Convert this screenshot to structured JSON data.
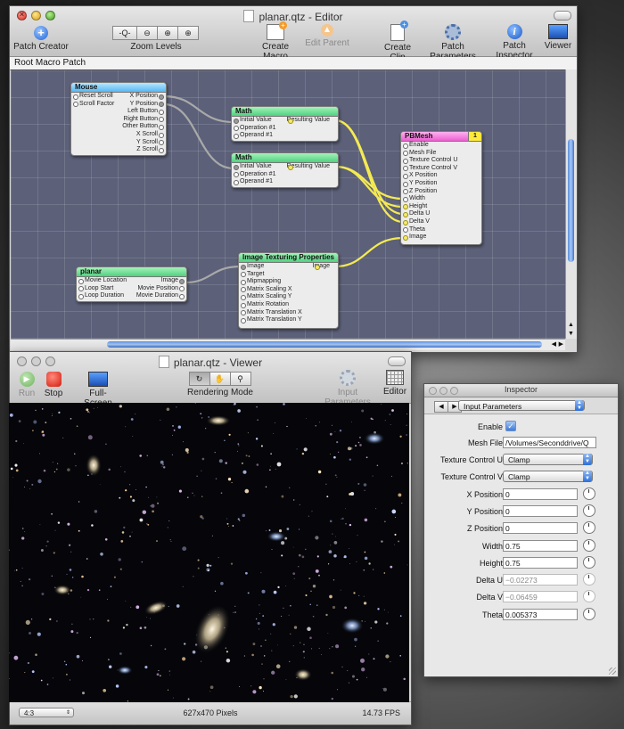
{
  "editor": {
    "title": "planar.qtz - Editor",
    "toolbar": {
      "patch_creator": "Patch Creator",
      "zoom_levels": "Zoom Levels",
      "create_macro": "Create Macro",
      "edit_parent": "Edit Parent",
      "create_clip": "Create Clip",
      "patch_parameters": "Patch Parameters",
      "patch_inspector": "Patch Inspector",
      "viewer": "Viewer"
    },
    "breadcrumb": "Root Macro Patch",
    "patches": {
      "mouse": {
        "title": "Mouse",
        "inputs": [
          "Reset Scroll",
          "Scroll Factor"
        ],
        "outputs": [
          "X Position",
          "Y Position",
          "Left Button",
          "Right Button",
          "Other Button",
          "X Scroll",
          "Y Scroll",
          "Z Scroll"
        ]
      },
      "math1": {
        "title": "Math",
        "inputs": [
          "Initial Value",
          "Operation #1",
          "Operand #1"
        ],
        "output": "Resulting Value"
      },
      "math2": {
        "title": "Math",
        "inputs": [
          "Initial Value",
          "Operation #1",
          "Operand #1"
        ],
        "output": "Resulting Value"
      },
      "pbmesh": {
        "title": "PBMesh",
        "badge": "1",
        "inputs": [
          "Enable",
          "Mesh File",
          "Texture Control U",
          "Texture Control V",
          "X Position",
          "Y Position",
          "Z Position",
          "Width",
          "Height",
          "Delta U",
          "Delta V",
          "Theta",
          "Image"
        ]
      },
      "planar": {
        "title": "planar",
        "inputs": [
          "Movie Location",
          "Loop Start",
          "Loop Duration"
        ],
        "outputs": [
          "Image",
          "Movie Position",
          "Movie Duration"
        ]
      },
      "texturing": {
        "title": "Image Texturing Properties",
        "inputs": [
          "Image",
          "Target",
          "Mipmapping",
          "Matrix Scaling X",
          "Matrix Scaling Y",
          "Matrix Rotation",
          "Matrix Translation X",
          "Matrix Translation Y"
        ],
        "output": "Image"
      }
    }
  },
  "viewer": {
    "title": "planar.qtz - Viewer",
    "run": "Run",
    "stop": "Stop",
    "fullscreen": "Full-Screen",
    "rendering_mode": "Rendering Mode",
    "input_parameters": "Input Parameters",
    "editor": "Editor",
    "aspect": "4:3",
    "size": "627x470 Pixels",
    "fps": "14.73 FPS"
  },
  "inspector": {
    "title": "Inspector",
    "mode": "Input Parameters",
    "enable_label": "Enable",
    "enable_checked": true,
    "mesh_file_label": "Mesh File",
    "mesh_file": "/Volumes/Seconddrive/Q",
    "texture_u_label": "Texture Control U",
    "texture_u": "Clamp",
    "texture_v_label": "Texture Control V",
    "texture_v": "Clamp",
    "x_label": "X Position",
    "x": "0",
    "y_label": "Y Position",
    "y": "0",
    "z_label": "Z Position",
    "z": "0",
    "width_label": "Width",
    "width": "0.75",
    "height_label": "Height",
    "height": "0.75",
    "du_label": "Delta U",
    "du": "−0.02273",
    "dv_label": "Delta V",
    "dv": "−0.06459",
    "theta_label": "Theta",
    "theta": "0.005373"
  }
}
